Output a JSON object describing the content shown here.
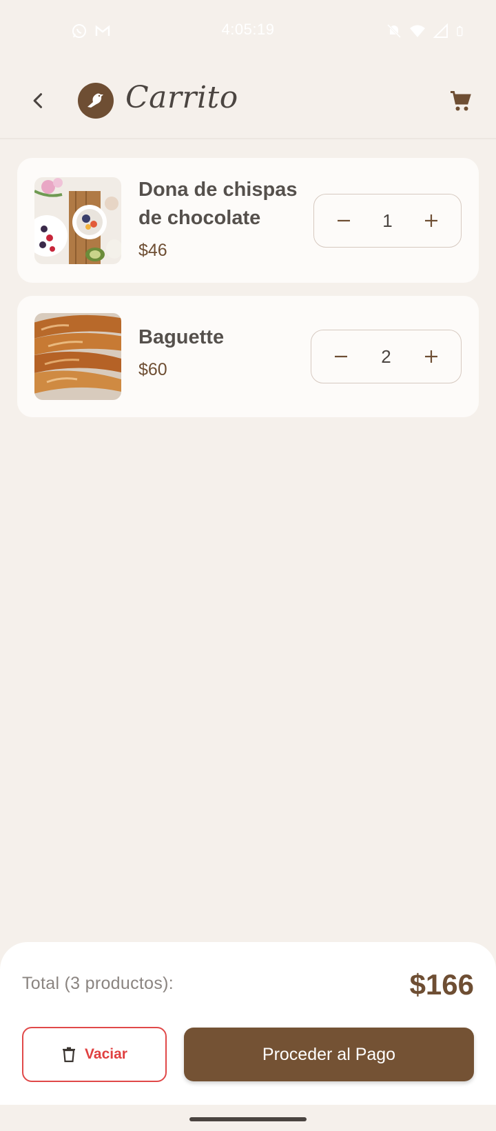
{
  "status_bar": {
    "time": "4:05:19",
    "left_icons": [
      "whatsapp-icon",
      "gmail-icon"
    ],
    "right_icons": [
      "mute-icon",
      "wifi-icon",
      "signal-icon",
      "battery-icon"
    ]
  },
  "app_bar": {
    "title": "Carrito",
    "back_icon": "back-arrow-icon",
    "logo_icon": "bird-logo-icon",
    "cart_icon": "shopping-cart-icon"
  },
  "cart": {
    "items": [
      {
        "name": "Dona de chispas de chocolate",
        "price": "$46",
        "quantity": "1",
        "image": "food-bowls-photo"
      },
      {
        "name": "Baguette",
        "price": "$60",
        "quantity": "2",
        "image": "baguette-photo"
      }
    ]
  },
  "summary": {
    "total_label": "Total (3 productos):",
    "total_value": "$166",
    "empty_button_label": "Vaciar",
    "pay_button_label": "Proceder al Pago"
  },
  "colors": {
    "background": "#f5f0eb",
    "brand_brown": "#745234",
    "danger_red": "#e04040",
    "card": "#fdfbf9"
  }
}
